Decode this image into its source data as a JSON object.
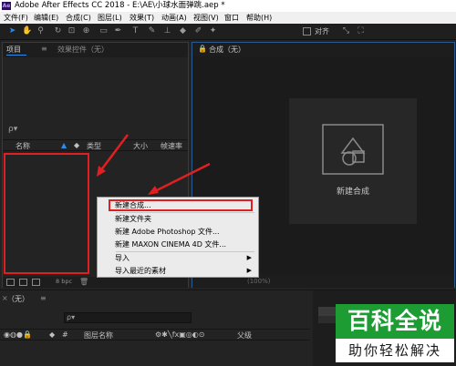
{
  "window": {
    "app_badge": "Ae",
    "title": "Adobe After Effects CC 2018 - E:\\AE\\小球水面弹跳.aep *"
  },
  "menu": [
    "文件(F)",
    "编辑(E)",
    "合成(C)",
    "图层(L)",
    "效果(T)",
    "动画(A)",
    "视图(V)",
    "窗口",
    "帮助(H)"
  ],
  "toolbar": {
    "tools": [
      "selection-tool-icon",
      "hand-tool-icon",
      "zoom-tool-icon",
      "rotate-tool-icon",
      "camera-tool-icon",
      "pan-behind-tool-icon",
      "rectangle-tool-icon",
      "pen-tool-icon",
      "type-tool-icon",
      "brush-tool-icon",
      "clone-stamp-tool-icon",
      "eraser-tool-icon",
      "roto-brush-tool-icon",
      "puppet-tool-icon"
    ],
    "snap_label": "对齐"
  },
  "project_panel": {
    "tab_project": "项目",
    "tab_effects": "效果控件（无）",
    "search_icon": "ρ▾",
    "columns": {
      "name": "名称",
      "type": "类型",
      "size": "大小",
      "frame_rate": "帧速率"
    },
    "bpc": "8 bpc"
  },
  "composition_panel": {
    "tab": "合成（无）",
    "new_comp_label": "新建合成",
    "bottom_bar": "(100%)"
  },
  "context_menu": {
    "items": [
      {
        "label": "新建合成...",
        "submenu": false
      },
      {
        "label": "新建文件夹",
        "submenu": false
      },
      {
        "label": "新建 Adobe Photoshop 文件...",
        "submenu": false
      },
      {
        "label": "新建 MAXON CINEMA 4D 文件...",
        "submenu": false
      },
      {
        "label": "导入",
        "submenu": true
      },
      {
        "label": "导入最近的素材",
        "submenu": true
      }
    ],
    "submenu_arrow": "▶"
  },
  "timeline": {
    "tab": "（无）",
    "search_icon": "ρ▾",
    "columns": {
      "index": "#",
      "layer_name": "图层名称",
      "parent": "父级"
    }
  },
  "watermark": {
    "main": "百科全说",
    "sub": "助你轻松解决"
  },
  "colors": {
    "annotation_red": "#e02020",
    "accent_blue": "#2d8ceb",
    "watermark_green": "#1d9c34"
  }
}
